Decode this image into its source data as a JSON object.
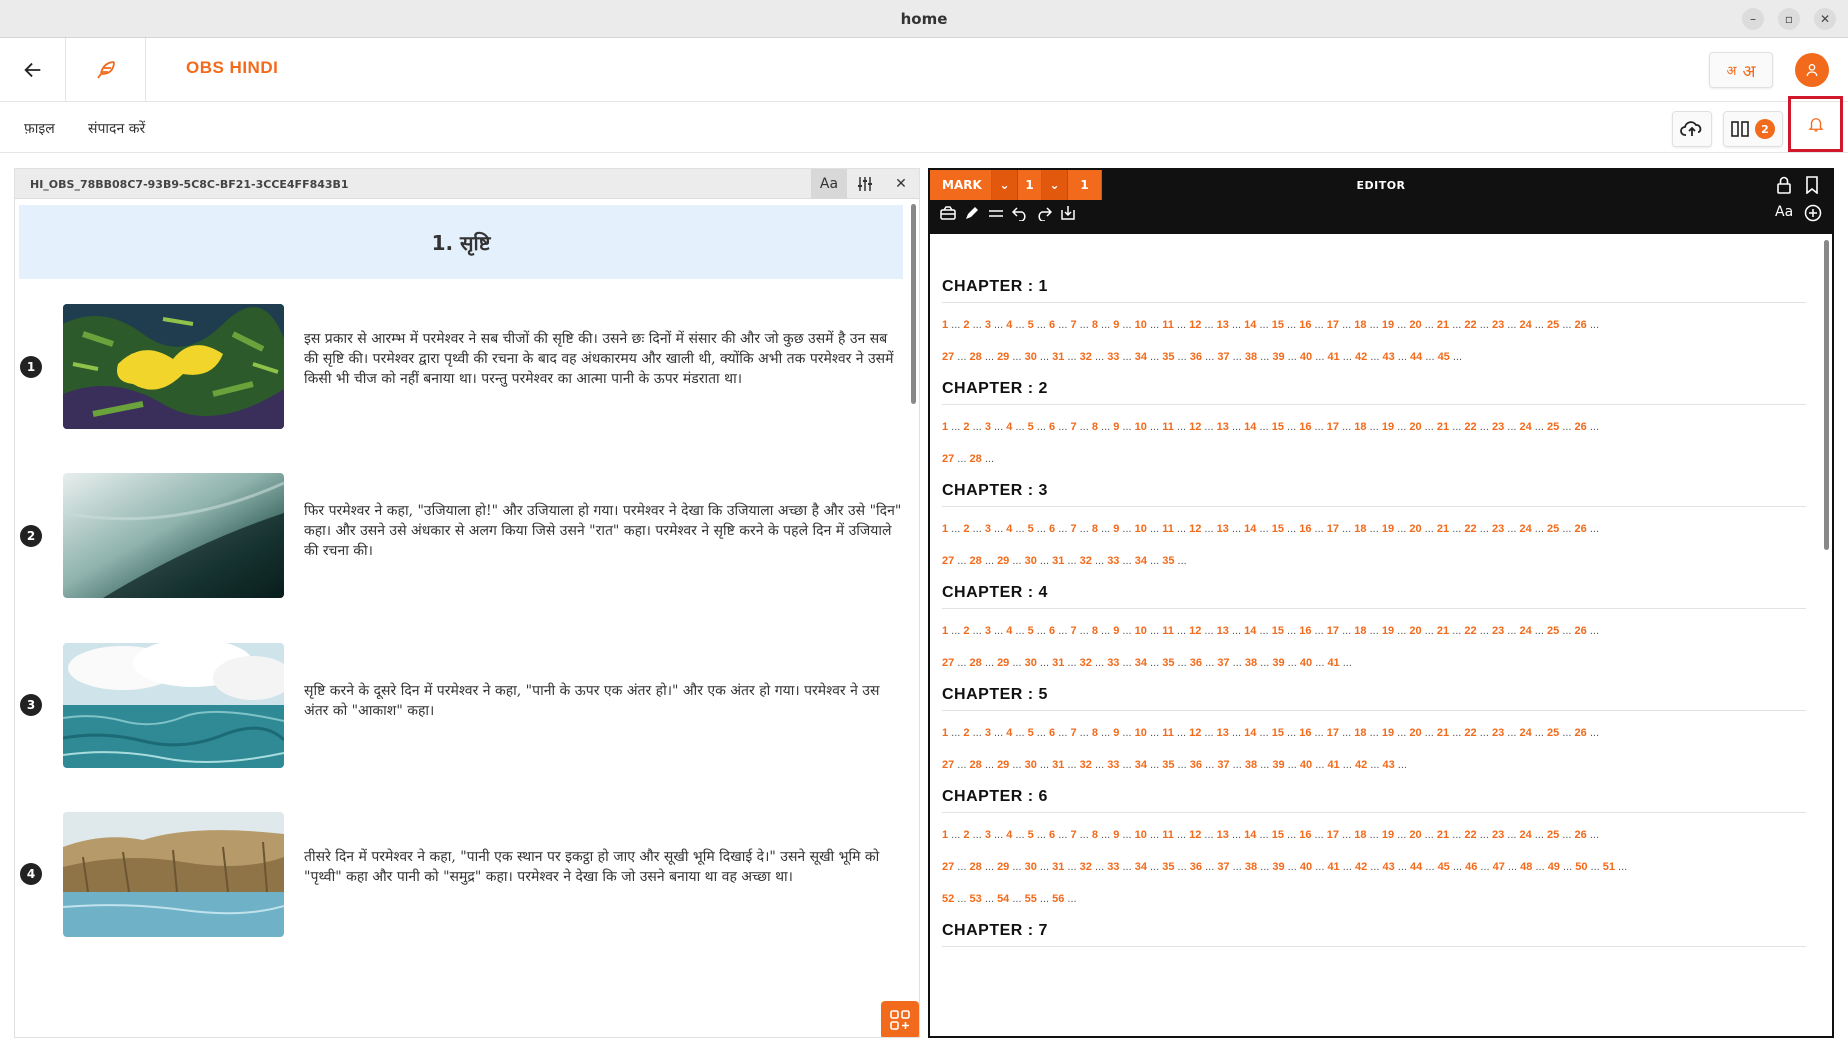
{
  "window": {
    "title": "home"
  },
  "header": {
    "project_name": "OBS HINDI",
    "font_toggle": [
      "अ",
      "अ"
    ]
  },
  "menu": {
    "file": "फ़ाइल",
    "edit": "संपादन करें",
    "layout_badge": "2"
  },
  "reference": {
    "resource_id": "HI_OBS_78BB08C7-93B9-5C8C-BF21-3CCE4FF843B1",
    "story_title": "1. सृष्टि",
    "frames": [
      {
        "num": "1",
        "text": "इस प्रकार से आरम्भ में परमेश्वर ने सब चीजों की सृष्टि की। उसने छः दिनों में संसार की और जो कुछ उसमें है उन सब की सृष्टि की। परमेश्वर द्वारा पृथ्वी की रचना के बाद वह अंधकारमय और खाली थी, क्योंकि अभी तक परमेश्वर ने उसमें किसी भी चीज को नहीं बनाया था। परन्तु परमेश्वर का आत्मा पानी के ऊपर मंडराता था।"
      },
      {
        "num": "2",
        "text": "फिर परमेश्वर ने कहा, \"उजियाला हो!\" और उजियाला हो गया। परमेश्वर ने देखा कि उजियाला अच्छा है और उसे \"दिन\" कहा। और उसने उसे अंधकार से अलग किया जिसे उसने \"रात\" कहा। परमेश्वर ने सृष्टि करने के पहले दिन में उजियाले की रचना की।"
      },
      {
        "num": "3",
        "text": "सृष्टि करने के दूसरे दिन में परमेश्वर ने कहा, \"पानी के ऊपर एक अंतर हो।\" और एक अंतर हो गया। परमेश्वर ने उस अंतर को \"आकाश\" कहा।"
      },
      {
        "num": "4",
        "text": "तीसरे दिन में परमेश्वर ने कहा, \"पानी एक स्थान पर इकट्ठा हो जाए और सूखी भूमि दिखाई दे।\" उसने सूखी भूमि को \"पृथ्वी\" कहा और पानी को \"समुद्र\" कहा। परमेश्वर ने देखा कि जो उसने बनाया था वह अच्छा था।"
      }
    ]
  },
  "editor": {
    "mark_label": "MARK",
    "chapter_select": "1",
    "verse_select": "1",
    "title": "EDITOR",
    "chapter_prefix": "CHAPTER : ",
    "chapters": [
      {
        "num": "1",
        "verses": 45
      },
      {
        "num": "2",
        "verses": 28
      },
      {
        "num": "3",
        "verses": 35
      },
      {
        "num": "4",
        "verses": 41
      },
      {
        "num": "5",
        "verses": 43
      },
      {
        "num": "6",
        "verses": 56
      },
      {
        "num": "7",
        "verses": 0
      }
    ]
  },
  "colors": {
    "accent": "#f26a1b",
    "editor_bg": "#111111",
    "story_title_bg": "#e4f0fb",
    "highlight_box": "#d0182a"
  }
}
